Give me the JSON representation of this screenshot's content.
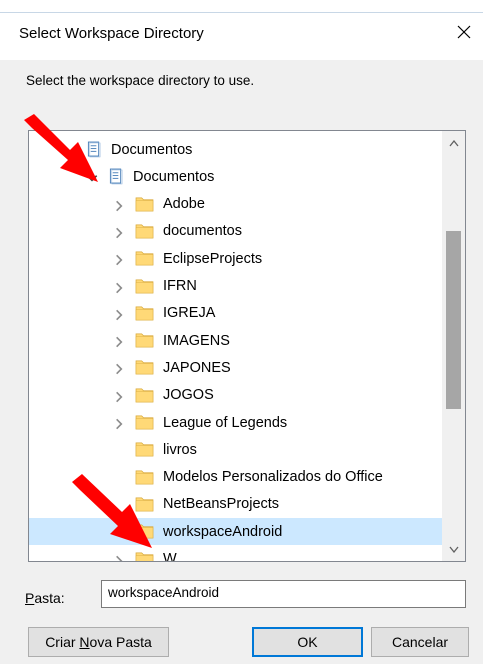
{
  "dialog": {
    "title": "Select Workspace Directory",
    "instruction": "Select the workspace directory to use."
  },
  "tree": {
    "root": {
      "label": "Documentos",
      "icon": "documents-library-icon"
    },
    "expanded": {
      "label": "Documentos",
      "icon": "documents-library-icon",
      "expanded": true
    },
    "items": [
      {
        "label": "Adobe",
        "has_children": true
      },
      {
        "label": "documentos",
        "has_children": true
      },
      {
        "label": "EclipseProjects",
        "has_children": true
      },
      {
        "label": "IFRN",
        "has_children": true
      },
      {
        "label": "IGREJA",
        "has_children": true
      },
      {
        "label": "IMAGENS",
        "has_children": true
      },
      {
        "label": "JAPONES",
        "has_children": true
      },
      {
        "label": "JOGOS",
        "has_children": true
      },
      {
        "label": "League of Legends",
        "has_children": true
      },
      {
        "label": "livros",
        "has_children": false
      },
      {
        "label": "Modelos Personalizados do Office",
        "has_children": false
      },
      {
        "label": "NetBeansProjects",
        "has_children": false
      },
      {
        "label": "workspaceAndroid",
        "has_children": false,
        "selected": true
      },
      {
        "label": "W",
        "has_children": true
      }
    ],
    "selected_color": "#cce8ff",
    "folder_color": "#ffd977"
  },
  "folder_field": {
    "label_prefix": "",
    "label_accel": "P",
    "label_rest": "asta:",
    "value": "workspaceAndroid"
  },
  "buttons": {
    "new_folder_pre": "Criar ",
    "new_folder_accel": "N",
    "new_folder_post": "ova Pasta",
    "ok": "OK",
    "cancel": "Cancelar"
  },
  "annotation": {
    "arrow_color": "#ff0000"
  }
}
